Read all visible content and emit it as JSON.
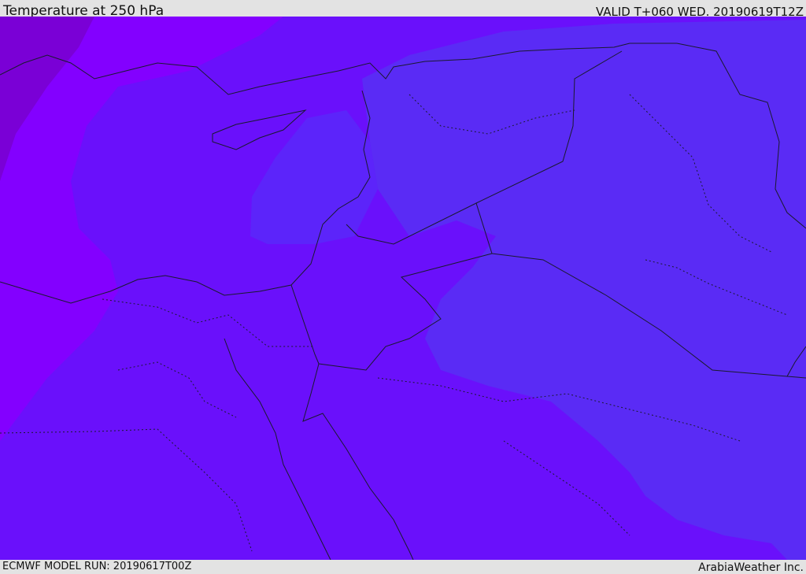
{
  "header": {
    "title": "Temperature at 250 hPa",
    "valid": "VALID T+060 WED. 20190619T12Z"
  },
  "footer": {
    "model_run": "ECMWF MODEL RUN: 20190617T00Z",
    "credit": "ArabiaWeather Inc."
  },
  "map": {
    "colors": {
      "coldest": "#7a00d6",
      "cold": "#8300ff",
      "mid": "#6a10fb",
      "mild": "#5c24fa",
      "warm": "#5a2bf5",
      "border": "#1a1a2e"
    }
  }
}
